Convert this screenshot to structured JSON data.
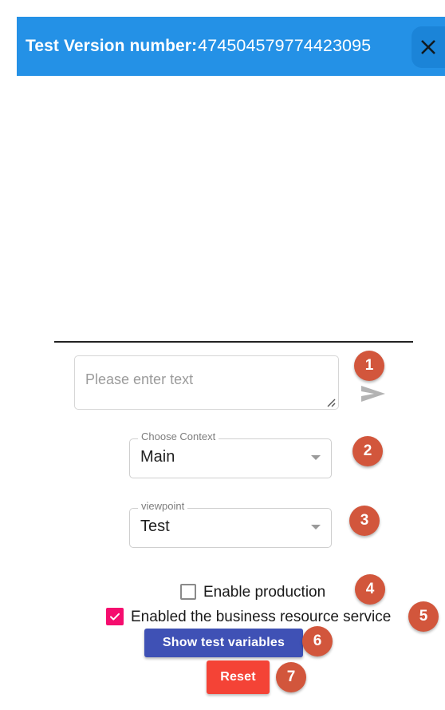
{
  "banner": {
    "label": "Test Version number:",
    "version": "474504579774423095",
    "background_color": "#2491e6",
    "close_icon": "close-icon"
  },
  "composer": {
    "textarea_placeholder": "Please enter text",
    "textarea_value": "",
    "send_icon": "send-icon",
    "resize_grip_icon": "resize-grip-icon"
  },
  "selects": [
    {
      "label": "Choose Context",
      "value": "Main",
      "arrow_icon": "chevron-down-icon"
    },
    {
      "label": "viewpoint",
      "value": "Test",
      "arrow_icon": "chevron-down-icon"
    }
  ],
  "checkboxes": [
    {
      "label": "Enable production",
      "checked": false
    },
    {
      "label": "Enabled the business resource service",
      "checked": true,
      "checked_color": "#f50d6e"
    }
  ],
  "buttons": {
    "show_variables": {
      "label": "Show test variables",
      "color": "#3f51b5"
    },
    "reset": {
      "label": "Reset",
      "color": "#f44336"
    }
  },
  "badges": {
    "color": "#d2563c",
    "one": "1",
    "two": "2",
    "three": "3",
    "four": "4",
    "five": "5",
    "six": "6",
    "seven": "7"
  }
}
